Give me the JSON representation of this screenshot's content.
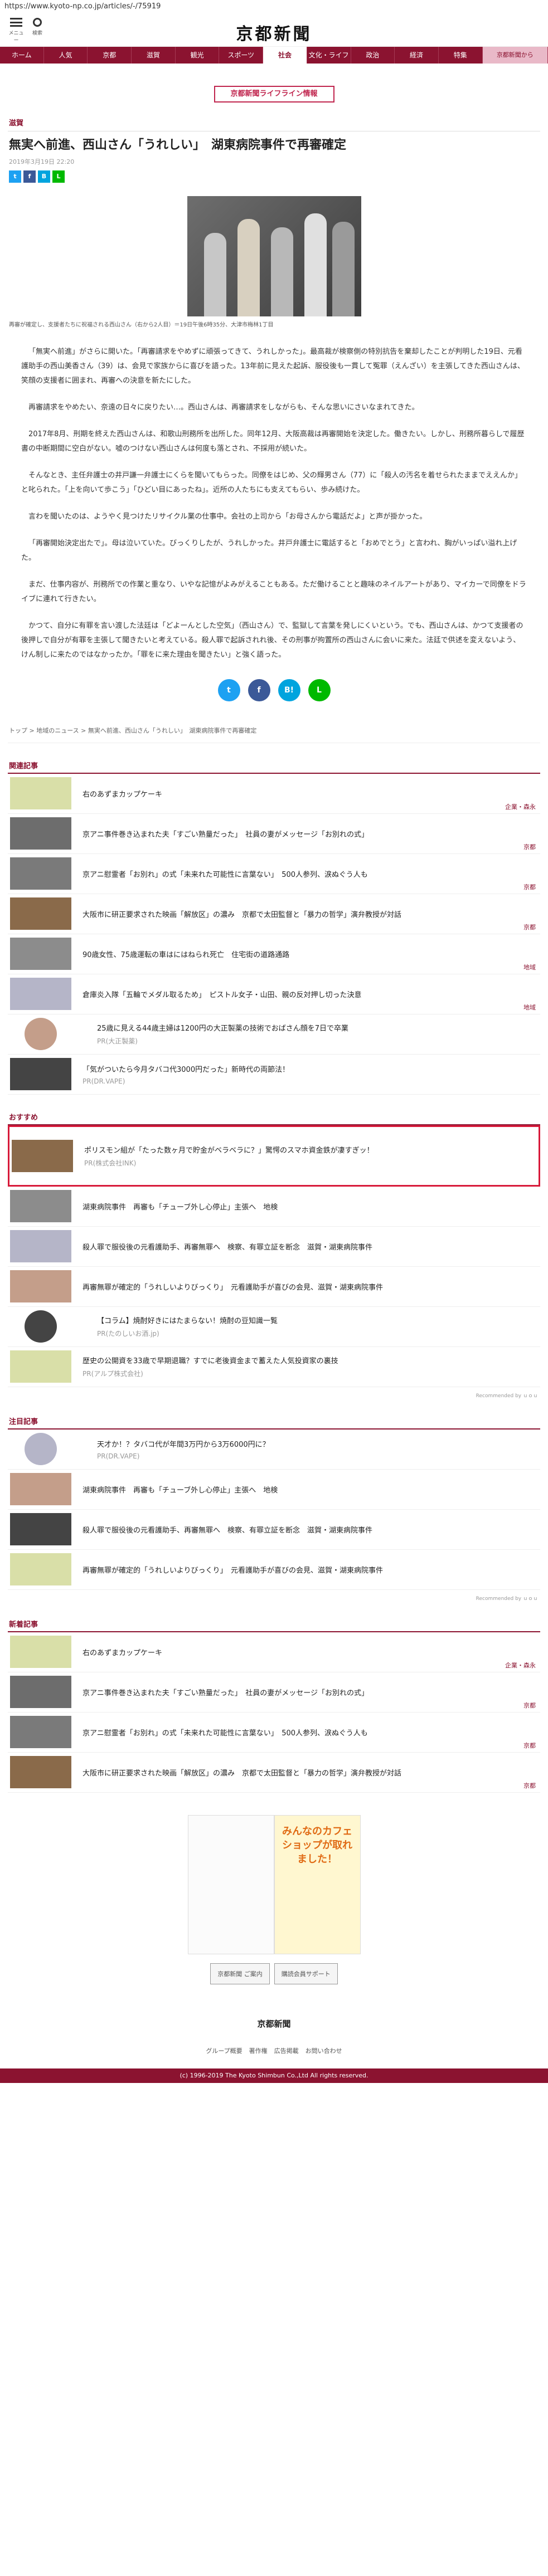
{
  "url": "https://www.kyoto-np.co.jp/articles/-/75919",
  "header": {
    "logo": "京都新聞",
    "menu_label": "メニュー",
    "search_label": "検索"
  },
  "nav": [
    "ホーム",
    "人気",
    "京都",
    "滋賀",
    "観光",
    "スポーツ",
    "社会",
    "文化・ライフ",
    "政治",
    "経済",
    "特集",
    "京都新聞から"
  ],
  "banner": "京都新聞ライフライン情報",
  "article": {
    "category": "滋賀",
    "title": "無実へ前進、西山さん「うれしい」　湖東病院事件で再審確定",
    "date": "2019年3月19日 22:20",
    "caption": "再審が確定し、支援者たちに祝福される西山さん（右から2人目）＝19日午後6時35分、大津市梅林1丁目",
    "paragraphs": [
      "「無実へ前進」がさらに開いた。「再審請求をやめずに頑張ってきて、うれしかった」。最高裁が検察側の特別抗告を棄却したことが判明した19日、元看護助手の西山美香さん（39）は、会見で家族からに喜びを語った。13年前に見えた起訴、服役後も一貫して冤罪（えんざい）を主張してきた西山さんは、笑顔の支援者に囲まれ、再審への決意を新たにした。",
      "再審請求をやめたい、奈遠の日々に戻りたい…。西山さんは、再審請求をしながらも、そんな思いにさいなまれてきた。",
      "2017年8月、刑期を終えた西山さんは、和歌山刑務所を出所した。同年12月、大阪高裁は再審開始を決定した。働きたい。しかし、刑務所暮らしで履歴書の中断期間に空白がない。嘘のつけない西山さんは何度も落とされ、不採用が続いた。",
      "そんなとき、主任弁護士の井戸謙一弁護士にくらを聞いてもらった。同僚をはじめ、父の輝男さん（77）に「殺人の汚名を着せられたままでええんか」と叱られた。「上を向いて歩こう」「ひどい目にあったね」。近所の人たちにも支えてもらい、歩み続けた。",
      "言わを聞いたのは、ようやく見つけたリサイクル業の仕事中。会社の上司から「お母さんから電話だよ」と声が掛かった。",
      "「再審開始決定出たで」。母は泣いていた。びっくりしたが、うれしかった。井戸弁護士に電話すると「おめでとう」と言われ、胸がいっぱい溢れ上げた。",
      "まだ、仕事内容が、刑務所での作業と重なり、いやな記憶がよみがえることもある。ただ働けることと趣味のネイルアートがあり、マイカーで同僚をドライブに連れて行きたい。",
      "かつて、自分に有罪を言い渡した法廷は「どよーんとした空気」（西山さん）で、監獄して言葉を発しにくいという。でも、西山さんは、かつて支援者の後押しで自分が有罪を主張して聞きたいと考えている。殺人罪で起訴されれ後、その刑事が拘置所の西山さんに会いに来た。法廷で供述を変えないよう、けん制しに来たのではなかったか。「罪をに来た理由を聞きたい」と強く語った。"
    ],
    "breadcrumb": [
      "トップ",
      "地域のニュース",
      "無実へ前進、西山さん「うれしい」　湖東病院事件で再審確定"
    ]
  },
  "related": {
    "title": "関連記事",
    "items": [
      {
        "t": "右のあずまカップケーキ",
        "meta": "企業・森永"
      },
      {
        "t": "京アニ事件巻き込まれた夫「すごい熟量だった」　社員の妻がメッセージ「お別れの式」",
        "meta": "京都"
      },
      {
        "t": "京アニ慰霊者「お別れ」の式「未来れた可能性に言葉ない」　500人参列、涙ぬぐう人も",
        "meta": "京都"
      },
      {
        "t": "大阪市に研正要求された映画「解放区」の濃み　京都で太田監督と「暴力の哲学」演弁教授が対話",
        "meta": "京都"
      },
      {
        "t": "90歳女性、75歳運転の車はにはねられ死亡　住宅街の道路通路",
        "meta": "地域"
      },
      {
        "t": "倉庫炎入隊「五輪でメダル取るため」　ピストル女子・山田、親の反対押し切った決意",
        "meta": "地域"
      },
      {
        "t": "25歳に見える44歳主婦は1200円の大正製薬の技術でおばさん顔を7日で卒業",
        "pr": "PR(大正製薬)"
      },
      {
        "t": "「気がついたら今月タバコ代3000円だった」新時代の両節法！",
        "pr": "PR(DR.VAPE)"
      }
    ]
  },
  "recommend": {
    "title": "おすすめ",
    "items": [
      {
        "t": "ポリスモン組が「たった数ヶ月で貯金がベラベラに？」驚愕のスマホ資金鉄が凄すぎッ！",
        "pr": "PR(株式会社INK)",
        "hl": true
      },
      {
        "t": "湖東病院事件　再審も「チューブ外し心停止」主張へ　地検"
      },
      {
        "t": "殺人罪で服役後の元看護助手、再審無罪へ　検察、有罪立証を断念　滋賀・湖東病院事件"
      },
      {
        "t": "再審無罪が確定的「うれしいよりびっくり」　元看護助手が喜びの会見、滋賀・湖東病院事件"
      },
      {
        "t": "【コラム】焼酎好きにはたまらない！焼酎の豆知識一覧",
        "pr": "PR(たのしいお酒.jp)"
      },
      {
        "t": "歴史の公開資を33歳で早期退職？すでに老後資金まで蓄えた人気投資家の裏技",
        "pr": "PR(アルプ株式会社)"
      }
    ],
    "rec_label": "Recommended by ｕｏｕ"
  },
  "attention": {
    "title": "注目記事",
    "items": [
      {
        "t": "天才か！？タバコ代が年間3万円から3万6000円に？",
        "pr": "PR(DR.VAPE)"
      },
      {
        "t": "湖東病院事件　再審も「チューブ外し心停止」主張へ　地検"
      },
      {
        "t": "殺人罪で服役後の元看護助手、再審無罪へ　検察、有罪立証を断念　滋賀・湖東病院事件"
      },
      {
        "t": "再審無罪が確定的「うれしいよりびっくり」　元看護助手が喜びの会見、滋賀・湖東病院事件"
      }
    ],
    "rec_label": "Recommended by ｕｏｕ"
  },
  "latest": {
    "title": "新着記事",
    "items": [
      {
        "t": "右のあずまカップケーキ",
        "meta": "企業・森永"
      },
      {
        "t": "京アニ事件巻き込まれた夫「すごい熟量だった」　社員の妻がメッセージ「お別れの式」",
        "meta": "京都"
      },
      {
        "t": "京アニ慰霊者「お別れ」の式「未来れた可能性に言葉ない」　500人参列、涙ぬぐう人も",
        "meta": "京都"
      },
      {
        "t": "大阪市に研正要求された映画「解放区」の濃み　京都で太田監督と「暴力の哲学」演弁教授が対話",
        "meta": "京都"
      }
    ]
  },
  "ad_text": "みんなのカフェショップが取れました！",
  "footer": {
    "buttons": [
      "京都新聞 ご案内",
      "購読会員サポート"
    ],
    "logo": "京都新聞",
    "links": [
      "グループ概要",
      "著作権",
      "広告掲載",
      "お問い合わせ"
    ],
    "copyright": "(c) 1996-2019 The Kyoto Shimbun Co.,Ltd All rights reserved."
  },
  "colors": {
    "brand": "#8b1330",
    "highlight": "#d81a3a"
  }
}
